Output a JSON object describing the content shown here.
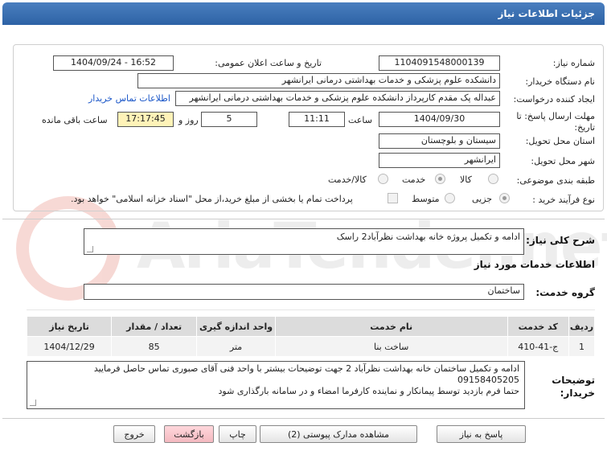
{
  "header": {
    "title": "جزئیات اطلاعات نیاز"
  },
  "form": {
    "need_number_label": "شماره نیاز:",
    "need_number": "1104091548000139",
    "announce_label": "تاریخ و ساعت اعلان عمومی:",
    "announce_value": "1404/09/24 - 16:52",
    "buyer_org_label": "نام دستگاه خریدار:",
    "buyer_org": "دانشکده علوم پزشکی و خدمات بهداشتی درمانی ایرانشهر",
    "creator_label": "ایجاد کننده درخواست:",
    "creator": "عبداله پک مقدم کارپرداز دانشکده علوم پزشکی و خدمات بهداشتی درمانی ایرانشهر",
    "contact_link": "اطلاعات تماس خریدار",
    "deadline_label": "مهلت ارسال پاسخ: تا تاریخ:",
    "deadline_date": "1404/09/30",
    "time_label": "ساعت",
    "deadline_time": "11:11",
    "days_value": "5",
    "days_label": "روز و",
    "remaining_time": "17:17:45",
    "remaining_label": "ساعت باقی مانده",
    "province_label": "استان محل تحویل:",
    "province": "سیستان و بلوچستان",
    "city_label": "شهر محل تحویل:",
    "city": "ایرانشهر",
    "category_label": "طبقه بندی موضوعی:",
    "category_options": [
      "کالا",
      "خدمت",
      "کالا/خدمت"
    ],
    "category_selected": "خدمت",
    "process_label": "نوع فرآیند خرید :",
    "process_options": [
      "جزیی",
      "متوسط"
    ],
    "process_selected": "جزیی",
    "payment_note": "پرداخت تمام یا بخشی از مبلغ خرید،از محل \"اسناد خزانه اسلامی\" خواهد بود."
  },
  "general_desc": {
    "label": "شرح کلی نیاز:",
    "value": "ادامه و تکمیل پروژه خانه بهداشت نظرآباد2 راسک"
  },
  "services": {
    "section_title": "اطلاعات خدمات مورد نیاز",
    "group_label": "گروه خدمت:",
    "group_value": "ساختمان",
    "columns": [
      "ردیف",
      "کد خدمت",
      "نام خدمت",
      "واحد اندازه گیری",
      "تعداد / مقدار",
      "تاریخ نیاز"
    ],
    "rows": [
      [
        "1",
        "ج-41-410",
        "ساخت بنا",
        "متر",
        "85",
        "1404/12/29"
      ]
    ]
  },
  "buyer_notes": {
    "label": "توضیحات خریدار:",
    "line1": "ادامه و تکمیل ساختمان خانه بهداشت نظرآباد 2  جهت توضیحات بیشتر با واحد فنی آقای صبوری تماس حاصل فرمایید",
    "line2": "09158405205",
    "line3": "حتما فرم بازدید توسط پیمانکار و نماینده کارفرما امضاء و در سامانه بارگذاری شود"
  },
  "buttons": {
    "reply": "پاسخ به نیاز",
    "attachments": "مشاهده مدارک پیوستی (2)",
    "print": "چاپ",
    "back": "بازگشت",
    "exit": "خروج"
  },
  "watermark": {
    "text": "AriaTender.net"
  },
  "colors": {
    "title_bar": "#2d62a5",
    "link": "#1a56c8",
    "highlight": "#fff3b8",
    "pink_button": "#f4b9c0"
  }
}
